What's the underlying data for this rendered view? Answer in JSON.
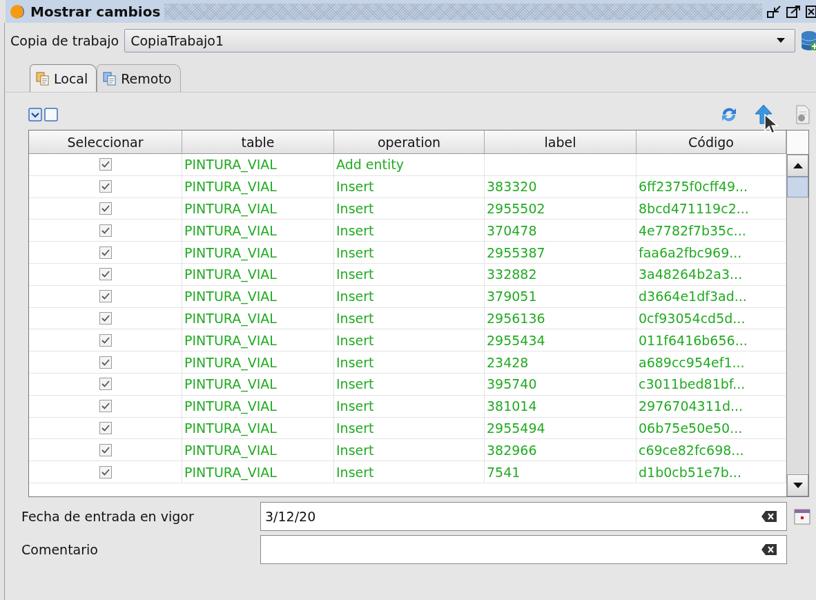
{
  "window": {
    "title": "Mostrar cambios"
  },
  "working_copy": {
    "label": "Copia de trabajo",
    "value": "CopiaTrabajo1"
  },
  "tabs": [
    {
      "label": "Local",
      "selected": true
    },
    {
      "label": "Remoto",
      "selected": false
    }
  ],
  "table": {
    "columns": [
      "Seleccionar",
      "table",
      "operation",
      "label",
      "Código"
    ],
    "rows": [
      {
        "checked": true,
        "table": "PINTURA_VIAL",
        "operation": "Add entity"
      },
      {
        "checked": true,
        "table": "PINTURA_VIAL",
        "operation": "Insert",
        "label": "383320",
        "code": "6ff2375f0cff49..."
      },
      {
        "checked": true,
        "table": "PINTURA_VIAL",
        "operation": "Insert",
        "label": "2955502",
        "code": "8bcd471119c2..."
      },
      {
        "checked": true,
        "table": "PINTURA_VIAL",
        "operation": "Insert",
        "label": "370478",
        "code": "4e7782f7b35c..."
      },
      {
        "checked": true,
        "table": "PINTURA_VIAL",
        "operation": "Insert",
        "label": "2955387",
        "code": "faa6a2fbc969..."
      },
      {
        "checked": true,
        "table": "PINTURA_VIAL",
        "operation": "Insert",
        "label": "332882",
        "code": "3a48264b2a3..."
      },
      {
        "checked": true,
        "table": "PINTURA_VIAL",
        "operation": "Insert",
        "label": "379051",
        "code": "d3664e1df3ad..."
      },
      {
        "checked": true,
        "table": "PINTURA_VIAL",
        "operation": "Insert",
        "label": "2956136",
        "code": "0cf93054cd5d..."
      },
      {
        "checked": true,
        "table": "PINTURA_VIAL",
        "operation": "Insert",
        "label": "2955434",
        "code": "011f6416b656..."
      },
      {
        "checked": true,
        "table": "PINTURA_VIAL",
        "operation": "Insert",
        "label": "23428",
        "code": "a689cc954ef1..."
      },
      {
        "checked": true,
        "table": "PINTURA_VIAL",
        "operation": "Insert",
        "label": "395740",
        "code": "c3011bed81bf..."
      },
      {
        "checked": true,
        "table": "PINTURA_VIAL",
        "operation": "Insert",
        "label": "381014",
        "code": "2976704311d..."
      },
      {
        "checked": true,
        "table": "PINTURA_VIAL",
        "operation": "Insert",
        "label": "2955494",
        "code": "06b75e50e50..."
      },
      {
        "checked": true,
        "table": "PINTURA_VIAL",
        "operation": "Insert",
        "label": "382966",
        "code": "c69ce82fc698..."
      },
      {
        "checked": true,
        "table": "PINTURA_VIAL",
        "operation": "Insert",
        "label": "7541",
        "code": "d1b0cb51e7b..."
      }
    ]
  },
  "effective_date": {
    "label": "Fecha de entrada en vigor",
    "value": "3/12/20"
  },
  "comment": {
    "label": "Comentario"
  }
}
